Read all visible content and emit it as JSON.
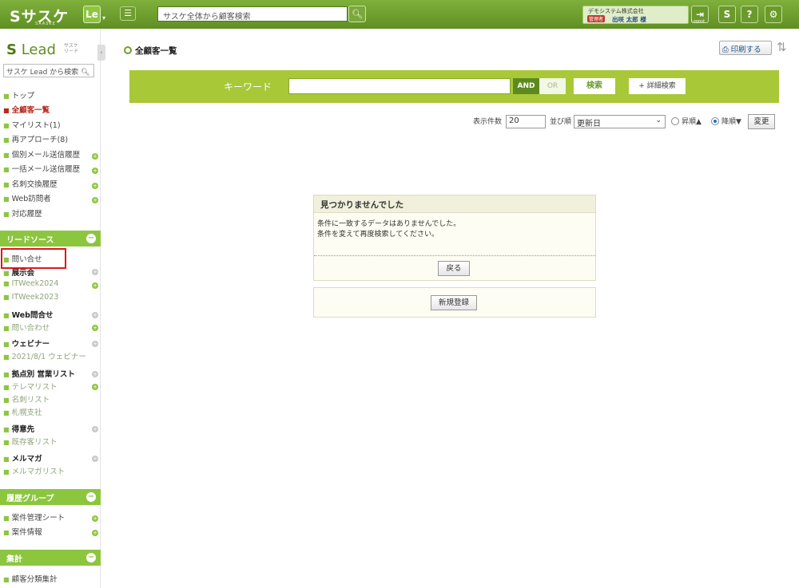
{
  "topbar": {
    "logo": "Sサスケ",
    "logo_sub": "SAASKE",
    "le_badge": "Le",
    "search_placeholder": "サスケ全体から顧客検索",
    "company": "デモシステム株式会社",
    "role": "管理者",
    "user": "出咲 太郎 様",
    "logout": "Logout",
    "help": "?"
  },
  "sidebar": {
    "logo": "Lead",
    "logo_mini": "サスケ リード",
    "search_placeholder": "サスケ Lead から検索",
    "nav": [
      {
        "label": "トップ"
      },
      {
        "label": "全顧客一覧"
      },
      {
        "label": "マイリスト(1)"
      },
      {
        "label": "再アプローチ(8)"
      },
      {
        "label": "個別メール送信履歴"
      },
      {
        "label": "一括メール送信履歴"
      },
      {
        "label": "名刺交換履歴"
      },
      {
        "label": "Web訪問者"
      },
      {
        "label": "対応履歴"
      }
    ],
    "sections": {
      "lead_source": "リードソース",
      "history_group": "履歴グループ",
      "aggregate": "集計"
    },
    "lead_items": [
      {
        "label": "問い合せ"
      },
      {
        "label": "展示会"
      },
      {
        "label": "ITWeek2024"
      },
      {
        "label": "ITWeek2023"
      },
      {
        "label": "Web問合せ"
      },
      {
        "label": "問い合わせ"
      },
      {
        "label": "ウェビナー"
      },
      {
        "label": "2021/8/1 ウェビナー"
      },
      {
        "label": "拠点別 営業リスト"
      },
      {
        "label": "テレマリスト"
      },
      {
        "label": "名刺リスト"
      },
      {
        "label": "札幌支社"
      },
      {
        "label": "得意先"
      },
      {
        "label": "既存客リスト"
      },
      {
        "label": "メルマガ"
      },
      {
        "label": "メルマガリスト"
      }
    ],
    "history_items": [
      {
        "label": "案件管理シート"
      },
      {
        "label": "案件情報"
      }
    ],
    "aggregate_items": [
      {
        "label": "顧客分類集計"
      }
    ]
  },
  "main": {
    "title": "全顧客一覧",
    "print": "印刷する",
    "keyword_label": "キーワード",
    "and": "AND",
    "or": "OR",
    "search": "検索",
    "advanced": "+ 詳細検索",
    "count_label": "表示件数",
    "count_value": "20",
    "sort_label": "並び順",
    "sort_value": "更新日",
    "asc": "昇順▲",
    "desc": "降順▼",
    "change": "変更",
    "not_found_title": "見つかりませんでした",
    "not_found_line1": "条件に一致するデータはありませんでした。",
    "not_found_line2": "条件を変えて再度検索してください。",
    "back": "戻る",
    "new": "新規登録"
  }
}
